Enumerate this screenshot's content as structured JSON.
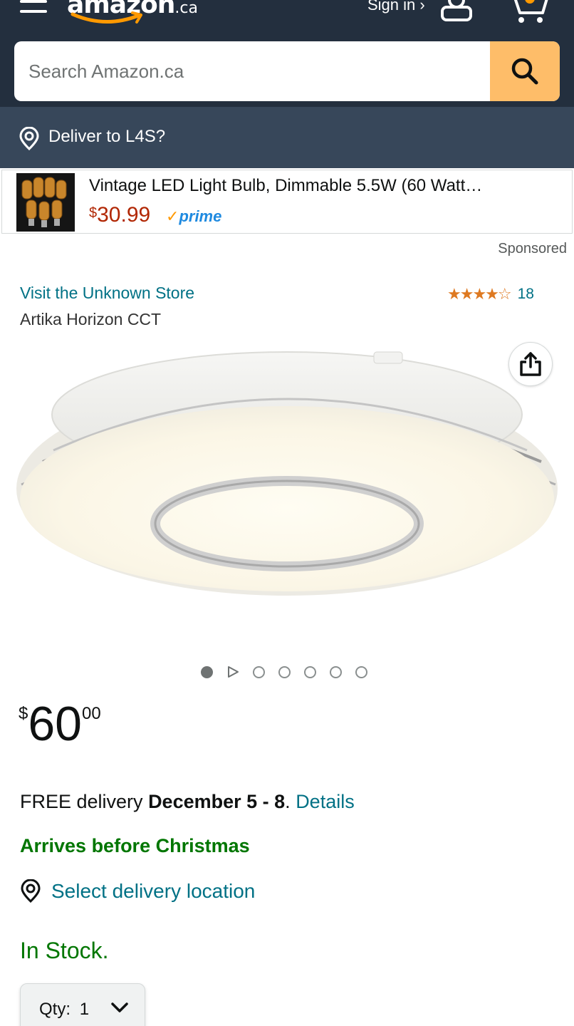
{
  "header": {
    "logo_brand": "amazon",
    "logo_tld": ".ca",
    "signin_label": "Sign in ›",
    "icons": {
      "menu": "menu-icon",
      "user": "user-icon",
      "cart": "cart-icon",
      "search": "search-icon"
    }
  },
  "search": {
    "placeholder": "Search Amazon.ca",
    "value": ""
  },
  "deliver": {
    "label": "Deliver to L4S?",
    "icon": "location-pin-icon"
  },
  "ad": {
    "title": "Vintage LED Light Bulb, Dimmable 5.5W (60 Watt…",
    "price_symbol": "$",
    "price_value": "30.99",
    "prime_check": "✓",
    "prime_label": "prime",
    "sponsored_label": "Sponsored"
  },
  "product": {
    "store_link": "Visit the Unknown Store",
    "name": "Artika Horizon CCT",
    "rating_stars": 4.5,
    "rating_count": "18",
    "image_count": 7,
    "active_image": 0,
    "price_symbol": "$",
    "price_whole": "60",
    "price_fraction": "00"
  },
  "delivery": {
    "free_prefix": "FREE delivery ",
    "date": "December 5 - 8",
    "period": ". ",
    "details_link": "Details",
    "arrives": "Arrives before Christmas",
    "select_location": "Select delivery location"
  },
  "stock": {
    "status": "In Stock.",
    "qty_label": "Qty:",
    "qty_value": "1"
  },
  "colors": {
    "header_bg": "#232f3e",
    "deliver_bg": "#37475a",
    "search_button": "#febd69",
    "link": "#007185",
    "in_stock": "#007600",
    "ad_price": "#b12704",
    "star": "#de7921"
  }
}
